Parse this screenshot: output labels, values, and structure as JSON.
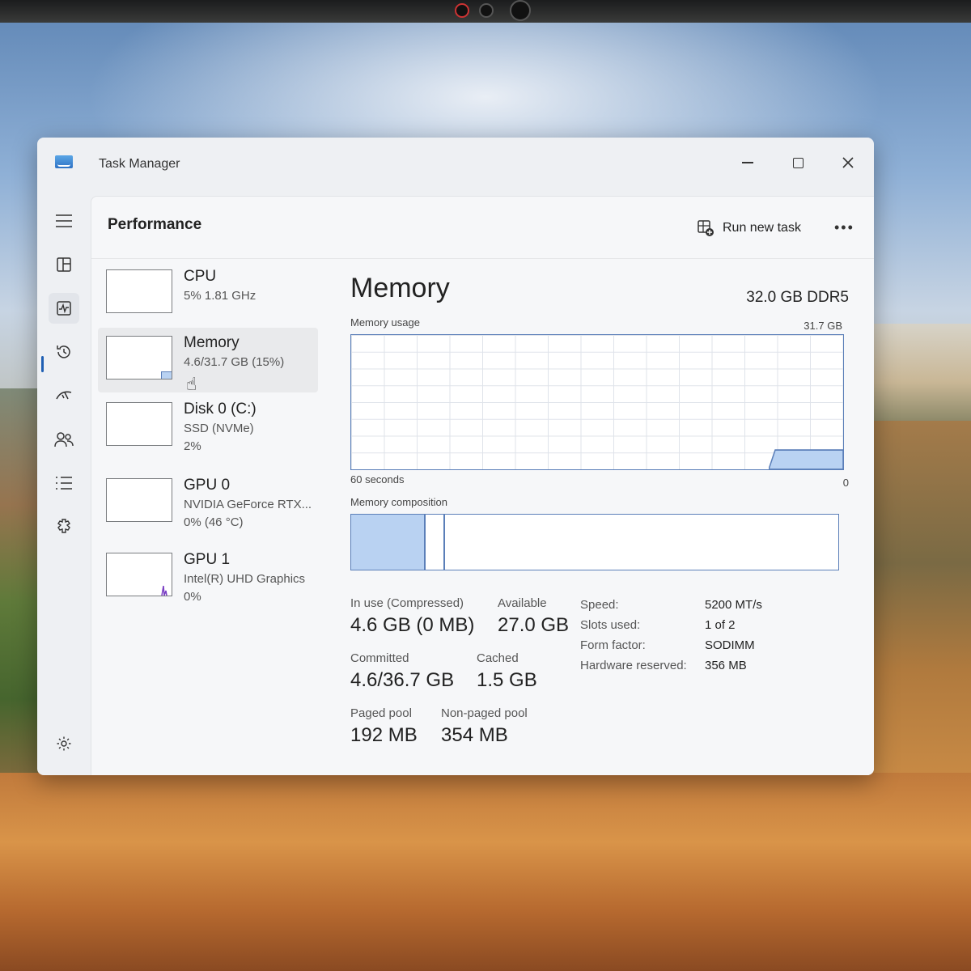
{
  "window": {
    "title": "Task Manager"
  },
  "nav": {
    "items": [
      "hamburger-menu-icon",
      "processes-icon",
      "performance-icon",
      "app-history-icon",
      "startup-apps-icon",
      "users-icon",
      "details-icon",
      "services-icon"
    ],
    "settings_icon": "gear-icon",
    "active": "performance-icon",
    "accent_color": "#1f5fb3"
  },
  "header": {
    "title": "Performance",
    "run_new_task": "Run new task",
    "more_icon": "ellipsis-icon"
  },
  "devices": [
    {
      "name": "CPU",
      "line1": "5% 1.81 GHz",
      "line2": ""
    },
    {
      "name": "Memory",
      "line1": "4.6/31.7 GB (15%)",
      "line2": ""
    },
    {
      "name": "Disk 0 (C:)",
      "line1": "SSD (NVMe)",
      "line2": "2%"
    },
    {
      "name": "GPU 0",
      "line1": "NVIDIA GeForce RTX...",
      "line2": "0%  (46 °C)"
    },
    {
      "name": "GPU 1",
      "line1": "Intel(R) UHD Graphics",
      "line2": "0%"
    }
  ],
  "selected_device": "Memory",
  "memory": {
    "title": "Memory",
    "total": "32.0 GB DDR5",
    "usage_label": "Memory usage",
    "usage_max": "31.7 GB",
    "time_span": "60 seconds",
    "axis_min": "0",
    "usage_fraction": 0.15,
    "composition_label": "Memory composition",
    "composition": {
      "in_use_fraction": 0.15,
      "modified_fraction": 0.04
    },
    "stats": {
      "in_use_label": "In use (Compressed)",
      "in_use_value": "4.6 GB (0 MB)",
      "available_label": "Available",
      "available_value": "27.0 GB",
      "committed_label": "Committed",
      "committed_value": "4.6/36.7 GB",
      "cached_label": "Cached",
      "cached_value": "1.5 GB",
      "paged_label": "Paged pool",
      "paged_value": "192 MB",
      "nonpaged_label": "Non-paged pool",
      "nonpaged_value": "354 MB"
    },
    "details": [
      {
        "label": "Speed:",
        "value": "5200 MT/s"
      },
      {
        "label": "Slots used:",
        "value": "1 of 2"
      },
      {
        "label": "Form factor:",
        "value": "SODIMM"
      },
      {
        "label": "Hardware reserved:",
        "value": "356 MB"
      }
    ],
    "graph_color": "#b9d2f2",
    "graph_border": "#5b7fb9"
  }
}
